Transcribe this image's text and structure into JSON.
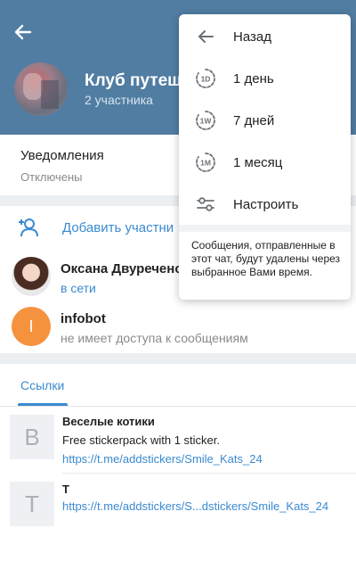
{
  "header": {
    "title": "Клуб путеш",
    "subtitle": "2 участника",
    "accent": "#517da2",
    "back_icon": "arrow-left-icon"
  },
  "notifications": {
    "title": "Уведомления",
    "status": "Отключены"
  },
  "members": {
    "add_label": "Добавить участни",
    "items": [
      {
        "name": "Оксана Двуреченс",
        "status": "в сети",
        "avatar": "photo"
      },
      {
        "name": "infobot",
        "status": "не имеет доступа к сообщениям",
        "avatar_letter": "I",
        "avatar_color": "#f5923e"
      }
    ]
  },
  "tabs": {
    "links_label": "Ссылки"
  },
  "links": [
    {
      "thumb_letter": "B",
      "title": "Веселые котики",
      "description": "Free stickerpack with 1 sticker.",
      "url": "https://t.me/addstickers/Smile_Kats_24"
    },
    {
      "thumb_letter": "T",
      "title": "T",
      "url": "https://t.me/addstickers/S...dstickers/Smile_Kats_24"
    }
  ],
  "popup": {
    "items": [
      {
        "label": "Назад",
        "icon": "arrow-left-icon"
      },
      {
        "label": "1 день",
        "icon": "timer-1d-icon",
        "badge": "1D"
      },
      {
        "label": "7 дней",
        "icon": "timer-1w-icon",
        "badge": "1W"
      },
      {
        "label": "1 месяц",
        "icon": "timer-1m-icon",
        "badge": "1M"
      },
      {
        "label": "Настроить",
        "icon": "sliders-icon"
      }
    ],
    "note": "Сообщения, отправленные в этот чат, будут удалены через выбранное Вами время."
  },
  "colors": {
    "link_blue": "#3a8ad0",
    "secondary_text": "#8a8a8a",
    "section_gap": "#eceff1"
  }
}
